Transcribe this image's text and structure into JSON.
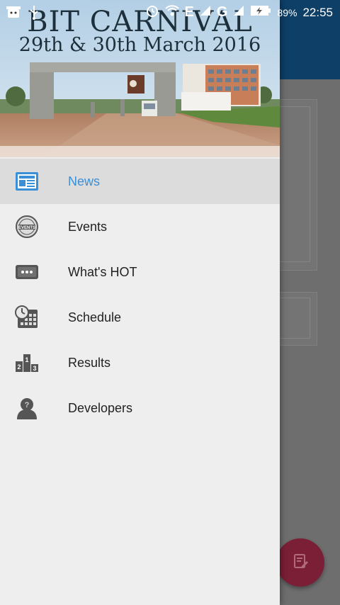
{
  "status_bar": {
    "network_letters": [
      "E",
      "G"
    ],
    "battery_percent": "89%",
    "time": "22:55",
    "icons": [
      "android-debug-icon",
      "usb-icon",
      "alarm-icon",
      "wifi-icon",
      "signal-icon",
      "battery-charging-icon"
    ]
  },
  "header": {
    "title": "BIT CARNIVAL",
    "subtitle": "29th & 30th March 2016"
  },
  "menu": {
    "items": [
      {
        "label": "News",
        "icon": "newspaper-icon",
        "active": true
      },
      {
        "label": "Events",
        "icon": "events-badge-icon",
        "active": false
      },
      {
        "label": "What's HOT",
        "icon": "ticket-dots-icon",
        "active": false
      },
      {
        "label": "Schedule",
        "icon": "calendar-clock-icon",
        "active": false
      },
      {
        "label": "Results",
        "icon": "podium-icon",
        "active": false
      },
      {
        "label": "Developers",
        "icon": "user-question-icon",
        "active": false
      }
    ]
  },
  "fab": {
    "icon": "edit-note-icon"
  },
  "colors": {
    "app_bar": "#0e3f66",
    "accent": "#3b8fd6",
    "fab": "#7b1f37",
    "drawer_bg": "#eeeeee",
    "active_item_bg": "#dcdcdc"
  }
}
